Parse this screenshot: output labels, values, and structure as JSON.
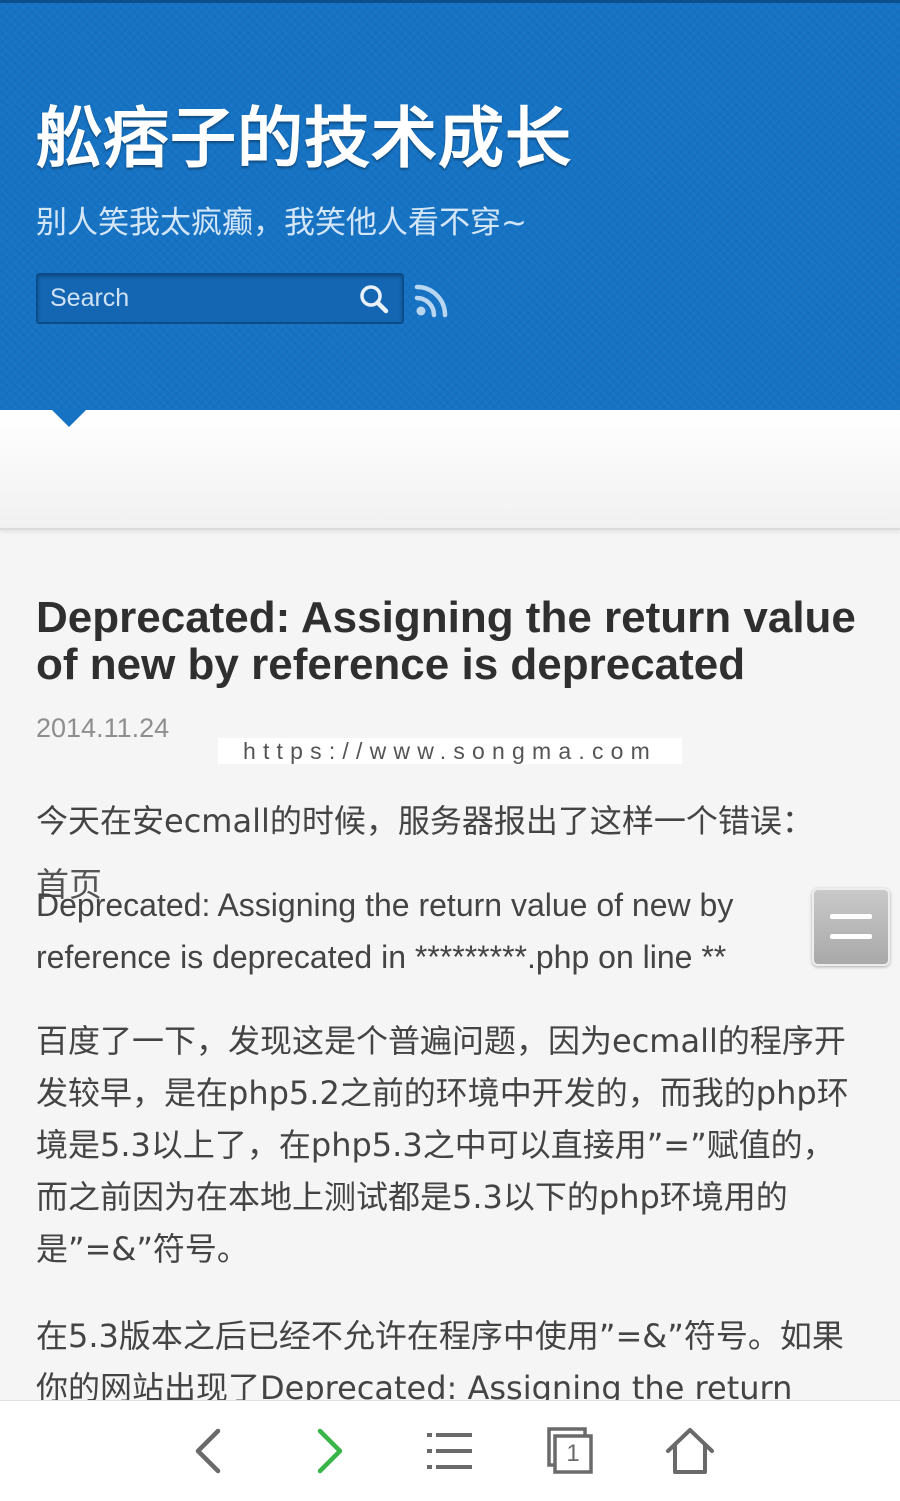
{
  "header": {
    "site_title": "舩痞子的技术成长",
    "tagline": "别人笑我太疯癫，我笑他人看不穿~",
    "search": {
      "placeholder": "Search",
      "value": ""
    },
    "icons": [
      "search-icon",
      "rss-icon"
    ],
    "background_color": "#1673c4"
  },
  "nav": {
    "items": [
      {
        "label": "首页",
        "active": true
      }
    ]
  },
  "post": {
    "title": "Deprecated: Assigning the return value of new by reference is deprecated",
    "date": "2014.11.24",
    "watermark": "https://www.songma.com",
    "paragraphs": [
      "今天在安ecmall的时候，服务器报出了这样一个错误：",
      "Deprecated: Assigning the return value of new by reference is deprecated in *********.php on line **",
      "百度了一下，发现这是个普遍问题，因为ecmall的程序开发较早，是在php5.2之前的环境中开发的，而我的php环境是5.3以上了，在php5.3之中可以直接用”=”赋值的，而之前因为在本地上测试都是5.3以下的php环境用的是”=&”符号。",
      "在5.3版本之后已经不允许在程序中使用”=&”符号。如果你的网站出现了Deprecated: Assigning the return value"
    ]
  },
  "floating_menu": {
    "icon": "menu-icon"
  },
  "browser_toolbar": {
    "buttons": [
      "back-icon",
      "forward-icon",
      "bookmarks-list-icon",
      "tabs-icon",
      "home-icon"
    ],
    "tab_count": "1",
    "forward_color": "#3ab54a"
  }
}
